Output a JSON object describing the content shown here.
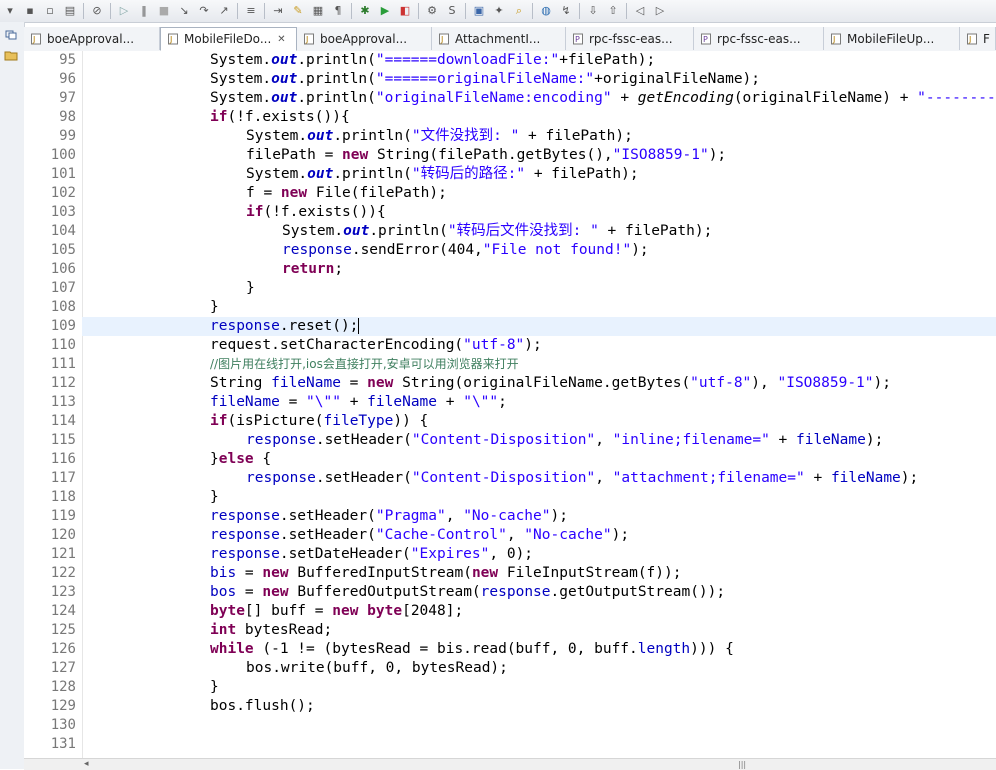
{
  "toolbar": {
    "icons": [
      "dropdown-arrow",
      "save-icon",
      "save-all-icon",
      "print-icon",
      "separator",
      "skip-breakpoints-icon",
      "separator",
      "resume-icon",
      "suspend-icon",
      "terminate-icon",
      "step-into-icon",
      "step-over-icon",
      "step-return-icon",
      "separator",
      "debug-console-icon",
      "separator",
      "run-to-line-icon",
      "mark-occurrences-icon",
      "block-selection-icon",
      "show-whitespace-icon",
      "separator",
      "debug-icon",
      "run-icon",
      "coverage-icon",
      "separator",
      "new-server-icon",
      "web-service-icon",
      "separator",
      "open-type-icon",
      "open-task-icon",
      "search-icon",
      "separator",
      "web-browser-icon",
      "external-tools-icon",
      "separator",
      "next-annotation-icon",
      "previous-annotation-icon",
      "separator",
      "back-icon",
      "forward-icon"
    ]
  },
  "tabs": [
    {
      "label": "boeApproval...",
      "type": "java"
    },
    {
      "label": "MobileFileDo...",
      "type": "java",
      "active": true,
      "close": "✕"
    },
    {
      "label": "boeApproval...",
      "type": "java"
    },
    {
      "label": "AttachmentI...",
      "type": "java"
    },
    {
      "label": "rpc-fssc-eas...",
      "type": "props"
    },
    {
      "label": "rpc-fssc-eas...",
      "type": "props"
    },
    {
      "label": "MobileFileUp...",
      "type": "java"
    },
    {
      "label": "F",
      "type": "java"
    }
  ],
  "editor": {
    "current_line": 109,
    "lines": [
      {
        "n": "95"
      },
      {
        "n": "96"
      },
      {
        "n": "97"
      },
      {
        "n": "98"
      },
      {
        "n": "99"
      },
      {
        "n": "100"
      },
      {
        "n": "101"
      },
      {
        "n": "102"
      },
      {
        "n": "103"
      },
      {
        "n": "104"
      },
      {
        "n": "105"
      },
      {
        "n": "106"
      },
      {
        "n": "107"
      },
      {
        "n": "108"
      },
      {
        "n": "109"
      },
      {
        "n": "110"
      },
      {
        "n": "111"
      },
      {
        "n": "112"
      },
      {
        "n": "113"
      },
      {
        "n": "114"
      },
      {
        "n": "115"
      },
      {
        "n": "116"
      },
      {
        "n": "117"
      },
      {
        "n": "118"
      },
      {
        "n": "119"
      },
      {
        "n": "120"
      },
      {
        "n": "121"
      },
      {
        "n": "122"
      },
      {
        "n": "123"
      },
      {
        "n": "124"
      },
      {
        "n": "125"
      },
      {
        "n": "126"
      },
      {
        "n": "127"
      },
      {
        "n": "128"
      },
      {
        "n": "129"
      },
      {
        "n": "130"
      },
      {
        "n": "131"
      }
    ],
    "code": {
      "l95": {
        "a": "System.",
        "b": "out",
        "c": ".println(",
        "d": "\"======downloadFile:\"",
        "e": "+filePath);"
      },
      "l96": {
        "a": "System.",
        "b": "out",
        "c": ".println(",
        "d": "\"======originalFileName:\"",
        "e": "+originalFileName);"
      },
      "l97": {
        "a": "System.",
        "b": "out",
        "c": ".println(",
        "d": "\"originalFileName:encoding\"",
        "e": " + ",
        "f": "getEncoding",
        "g": "(originalFileName) + ",
        "h": "\"--------"
      },
      "l98": {
        "a": "if",
        "b": "(!f.exists()){"
      },
      "l99": {
        "a": "System.",
        "b": "out",
        "c": ".println(",
        "d": "\"文件没找到: \"",
        "e": " + filePath);"
      },
      "l100": {
        "a": "filePath = ",
        "b": "new",
        "c": " String(filePath.getBytes(),",
        "d": "\"ISO8859-1\"",
        "e": ");"
      },
      "l101": {
        "a": "System.",
        "b": "out",
        "c": ".println(",
        "d": "\"转码后的路径:\"",
        "e": " + filePath);"
      },
      "l102": {
        "a": "f = ",
        "b": "new",
        "c": " File(filePath);"
      },
      "l103": {
        "a": "if",
        "b": "(!f.exists()){"
      },
      "l104": {
        "a": "System.",
        "b": "out",
        "c": ".println(",
        "d": "\"转码后文件没找到: \"",
        "e": " + filePath);"
      },
      "l105": {
        "a": "response",
        "b": ".sendError(404,",
        "c": "\"File not found!\"",
        "d": ");"
      },
      "l106": {
        "a": "return",
        "b": ";"
      },
      "l107": {
        "a": "}"
      },
      "l108": {
        "a": "}"
      },
      "l109": {
        "a": "response",
        "b": ".reset();"
      },
      "l110": {
        "a": "request.setCharacterEncoding(",
        "b": "\"utf-8\"",
        "c": ");"
      },
      "l111": {
        "a": "//图片用在线打开,ios会直接打开,安卓可以用浏览器来打开"
      },
      "l112": {
        "a": "String ",
        "b": "fileName",
        "c": " = ",
        "d": "new",
        "e": " String(originalFileName.getBytes(",
        "f": "\"utf-8\"",
        "g": "), ",
        "h": "\"ISO8859-1\"",
        "i": ");"
      },
      "l113": {
        "a": "fileName",
        "b": " = ",
        "c": "\"\\\"\"",
        "d": " + ",
        "e": "fileName",
        "f": " + ",
        "g": "\"\\\"\"",
        "h": ";"
      },
      "l114": {
        "a": "if",
        "b": "(isPicture(",
        "c": "fileType",
        "d": ")) {"
      },
      "l115": {
        "a": "response",
        "b": ".setHeader(",
        "c": "\"Content-Disposition\"",
        "d": ", ",
        "e": "\"inline;filename=\"",
        "f": " + ",
        "g": "fileName",
        "h": ");"
      },
      "l116": {
        "a": "}",
        "b": "else",
        "c": " {"
      },
      "l117": {
        "a": "response",
        "b": ".setHeader(",
        "c": "\"Content-Disposition\"",
        "d": ", ",
        "e": "\"attachment;filename=\"",
        "f": " + ",
        "g": "fileName",
        "h": ");"
      },
      "l118": {
        "a": "}"
      },
      "l119": {
        "a": "response",
        "b": ".setHeader(",
        "c": "\"Pragma\"",
        "d": ", ",
        "e": "\"No-cache\"",
        "f": ");"
      },
      "l120": {
        "a": "response",
        "b": ".setHeader(",
        "c": "\"Cache-Control\"",
        "d": ", ",
        "e": "\"No-cache\"",
        "f": ");"
      },
      "l121": {
        "a": "response",
        "b": ".setDateHeader(",
        "c": "\"Expires\"",
        "d": ", 0);"
      },
      "l122": {
        "a": "bis",
        "b": " = ",
        "c": "new",
        "d": " BufferedInputStream(",
        "e": "new",
        "f": " FileInputStream(f));"
      },
      "l123": {
        "a": "bos",
        "b": " = ",
        "c": "new",
        "d": " BufferedOutputStream(",
        "e": "response",
        "f": ".getOutputStream());"
      },
      "l124": {
        "a": "byte",
        "b": "[] buff = ",
        "c": "new",
        "d": " ",
        "e": "byte",
        "f": "[2048];"
      },
      "l125": {
        "a": "int",
        "b": " bytesRead;"
      },
      "l126": {
        "a": "while",
        "b": " (-1 != (bytesRead = bis.read(buff, 0, buff.",
        "c": "length",
        "d": "))) {"
      },
      "l127": {
        "a": "bos.write(buff, 0, bytesRead);"
      },
      "l128": {
        "a": "}"
      },
      "l129": {
        "a": "bos.flush();"
      }
    }
  },
  "scrollbar": {
    "left_arrow": "◂",
    "grip": "|||"
  }
}
